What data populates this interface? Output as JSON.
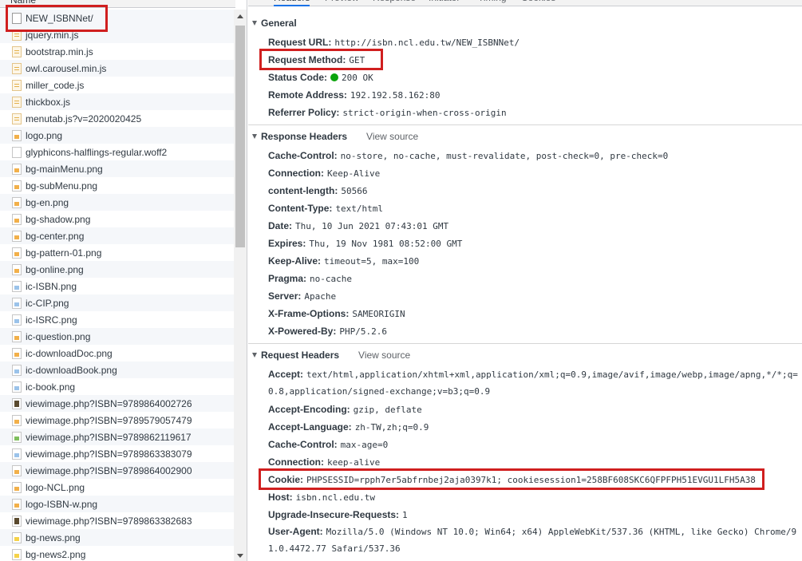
{
  "list": {
    "header": "Name",
    "items": [
      {
        "name": "NEW_ISBNNet/",
        "icon": "doc"
      },
      {
        "name": "jquery.min.js",
        "icon": "script"
      },
      {
        "name": "bootstrap.min.js",
        "icon": "script"
      },
      {
        "name": "owl.carousel.min.js",
        "icon": "script"
      },
      {
        "name": "miller_code.js",
        "icon": "script"
      },
      {
        "name": "thickbox.js",
        "icon": "script"
      },
      {
        "name": "menutab.js?v=2020020425",
        "icon": "script"
      },
      {
        "name": "logo.png",
        "icon": "img"
      },
      {
        "name": "glyphicons-halflings-regular.woff2",
        "icon": "font"
      },
      {
        "name": "bg-mainMenu.png",
        "icon": "img"
      },
      {
        "name": "bg-subMenu.png",
        "icon": "img"
      },
      {
        "name": "bg-en.png",
        "icon": "img"
      },
      {
        "name": "bg-shadow.png",
        "icon": "img"
      },
      {
        "name": "bg-center.png",
        "icon": "img"
      },
      {
        "name": "bg-pattern-01.png",
        "icon": "img"
      },
      {
        "name": "bg-online.png",
        "icon": "img"
      },
      {
        "name": "ic-ISBN.png",
        "icon": "img-blue"
      },
      {
        "name": "ic-CIP.png",
        "icon": "img-blue"
      },
      {
        "name": "ic-ISRC.png",
        "icon": "img-blue"
      },
      {
        "name": "ic-question.png",
        "icon": "img"
      },
      {
        "name": "ic-downloadDoc.png",
        "icon": "img"
      },
      {
        "name": "ic-downloadBook.png",
        "icon": "img-blue"
      },
      {
        "name": "ic-book.png",
        "icon": "img-blue"
      },
      {
        "name": "viewimage.php?ISBN=9789864002726",
        "icon": "img-dark"
      },
      {
        "name": "viewimage.php?ISBN=9789579057479",
        "icon": "img"
      },
      {
        "name": "viewimage.php?ISBN=9789862119617",
        "icon": "img-green"
      },
      {
        "name": "viewimage.php?ISBN=9789863383079",
        "icon": "img-blue"
      },
      {
        "name": "viewimage.php?ISBN=9789864002900",
        "icon": "img"
      },
      {
        "name": "logo-NCL.png",
        "icon": "img"
      },
      {
        "name": "logo-ISBN-w.png",
        "icon": "img"
      },
      {
        "name": "viewimage.php?ISBN=9789863382683",
        "icon": "img-dark"
      },
      {
        "name": "bg-news.png",
        "icon": "img-yellow"
      },
      {
        "name": "bg-news2.png",
        "icon": "img-yellow"
      }
    ]
  },
  "tabs": [
    "Headers",
    "Preview",
    "Response",
    "Initiator",
    "Timing",
    "Cookies"
  ],
  "general": {
    "title": "General",
    "rows": [
      {
        "key": "Request URL:",
        "value": "http://isbn.ncl.edu.tw/NEW_ISBNNet/"
      },
      {
        "key": "Request Method:",
        "value": "GET"
      },
      {
        "key": "Status Code:",
        "value": "200 OK"
      },
      {
        "key": "Remote Address:",
        "value": "192.192.58.162:80"
      },
      {
        "key": "Referrer Policy:",
        "value": "strict-origin-when-cross-origin"
      }
    ]
  },
  "response_headers": {
    "title": "Response Headers",
    "view_source": "View source",
    "rows": [
      {
        "key": "Cache-Control:",
        "value": "no-store, no-cache, must-revalidate, post-check=0, pre-check=0"
      },
      {
        "key": "Connection:",
        "value": "Keep-Alive"
      },
      {
        "key": "content-length:",
        "value": "50566"
      },
      {
        "key": "Content-Type:",
        "value": "text/html"
      },
      {
        "key": "Date:",
        "value": "Thu, 10 Jun 2021 07:43:01 GMT"
      },
      {
        "key": "Expires:",
        "value": "Thu, 19 Nov 1981 08:52:00 GMT"
      },
      {
        "key": "Keep-Alive:",
        "value": "timeout=5, max=100"
      },
      {
        "key": "Pragma:",
        "value": "no-cache"
      },
      {
        "key": "Server:",
        "value": "Apache"
      },
      {
        "key": "X-Frame-Options:",
        "value": "SAMEORIGIN"
      },
      {
        "key": "X-Powered-By:",
        "value": "PHP/5.2.6"
      }
    ]
  },
  "request_headers": {
    "title": "Request Headers",
    "view_source": "View source",
    "accept_key": "Accept:",
    "accept_line1": "text/html,application/xhtml+xml,application/xml;q=0.9,image/avif,image/webp,image/apng,*/*;q=",
    "accept_line2": "0.8,application/signed-exchange;v=b3;q=0.9",
    "rows": [
      {
        "key": "Accept-Encoding:",
        "value": "gzip, deflate"
      },
      {
        "key": "Accept-Language:",
        "value": "zh-TW,zh;q=0.9"
      },
      {
        "key": "Cache-Control:",
        "value": "max-age=0"
      },
      {
        "key": "Connection:",
        "value": "keep-alive"
      },
      {
        "key": "Cookie:",
        "value": "PHPSESSID=rpph7er5abfrnbej2aja0397k1; cookiesession1=258BF608SKC6QFPFPH51EVGU1LFH5A38"
      },
      {
        "key": "Host:",
        "value": "isbn.ncl.edu.tw"
      },
      {
        "key": "Upgrade-Insecure-Requests:",
        "value": "1"
      }
    ],
    "ua_key": "User-Agent:",
    "ua_line1": "Mozilla/5.0 (Windows NT 10.0; Win64; x64) AppleWebKit/537.36 (KHTML, like Gecko) Chrome/9",
    "ua_line2": "1.0.4472.77 Safari/537.36"
  },
  "colors": {
    "highlight": "#d01f1f",
    "status_ok": "#0ca40c",
    "tab_active": "#1a73e8"
  }
}
